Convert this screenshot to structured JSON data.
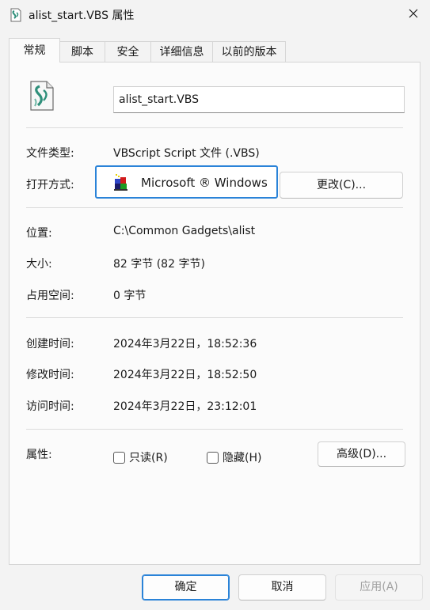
{
  "window": {
    "title": "alist_start.VBS 属性",
    "close_icon": "close-icon"
  },
  "tabs": [
    {
      "label": "常规",
      "active": true
    },
    {
      "label": "脚本",
      "active": false
    },
    {
      "label": "安全",
      "active": false
    },
    {
      "label": "详细信息",
      "active": false
    },
    {
      "label": "以前的版本",
      "active": false
    }
  ],
  "general": {
    "file_name": "alist_start.VBS",
    "file_type_label": "文件类型:",
    "file_type_value": "VBScript Script 文件 (.VBS)",
    "open_with_label": "打开方式:",
    "open_with_app": "Microsoft ® Windows",
    "change_button": "更改(C)...",
    "location_label": "位置:",
    "location_value": "C:\\Common Gadgets\\alist",
    "size_label": "大小:",
    "size_value": "82 字节 (82 字节)",
    "size_on_disk_label": "占用空间:",
    "size_on_disk_value": "0 字节",
    "created_label": "创建时间:",
    "created_value": "2024年3月22日，18:52:36",
    "modified_label": "修改时间:",
    "modified_value": "2024年3月22日，18:52:50",
    "accessed_label": "访问时间:",
    "accessed_value": "2024年3月22日，23:12:01",
    "attributes_label": "属性:",
    "readonly_label": "只读(R)",
    "readonly_checked": false,
    "hidden_label": "隐藏(H)",
    "hidden_checked": false,
    "advanced_button": "高级(D)..."
  },
  "footer": {
    "ok": "确定",
    "cancel": "取消",
    "apply": "应用(A)"
  },
  "colors": {
    "accent": "#2a83d8",
    "background": "#f3f3f3",
    "panel": "#fbfbfb"
  }
}
